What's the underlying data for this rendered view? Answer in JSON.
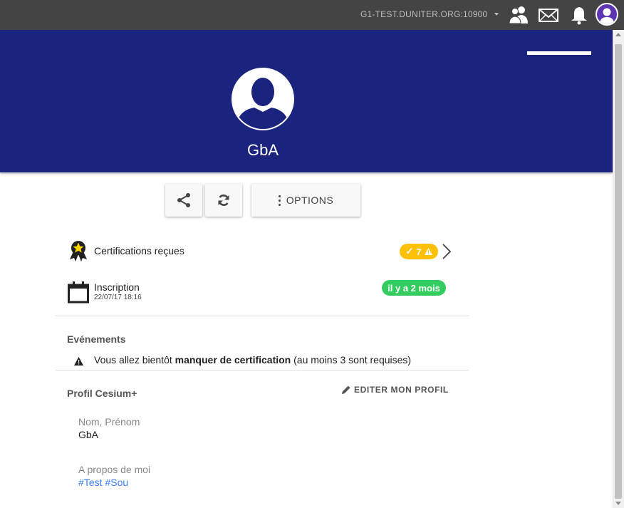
{
  "topbar": {
    "node": "G1-TEST.DUNITER.ORG:10900",
    "icons": [
      "users-icon",
      "mail-icon",
      "bell-icon",
      "user-avatar"
    ]
  },
  "profile": {
    "name": "GbA"
  },
  "actions": {
    "options_label": "OPTIONS"
  },
  "certifications": {
    "label": "Certifications reçues",
    "count": "7"
  },
  "inscription": {
    "label": "Inscription",
    "date": "22/07/17 18:16",
    "badge": "il y a 2 mois"
  },
  "events": {
    "title": "Evénements",
    "text_before": "Vous allez bientôt ",
    "text_bold": "manquer de certification",
    "text_after": " (au moins 3 sont requises)"
  },
  "cesium": {
    "title": "Profil Cesium+",
    "edit_label": "EDITER MON PROFIL",
    "name_label": "Nom, Prénom",
    "name_value": "GbA",
    "about_label": "A propos de moi",
    "tags": [
      "#Test",
      "#Sou"
    ]
  },
  "colors": {
    "topbar": "#444444",
    "hero": "#1a237e",
    "badge_warning": "#ffc107",
    "badge_success": "#33cd5f",
    "link": "#387ef5"
  }
}
